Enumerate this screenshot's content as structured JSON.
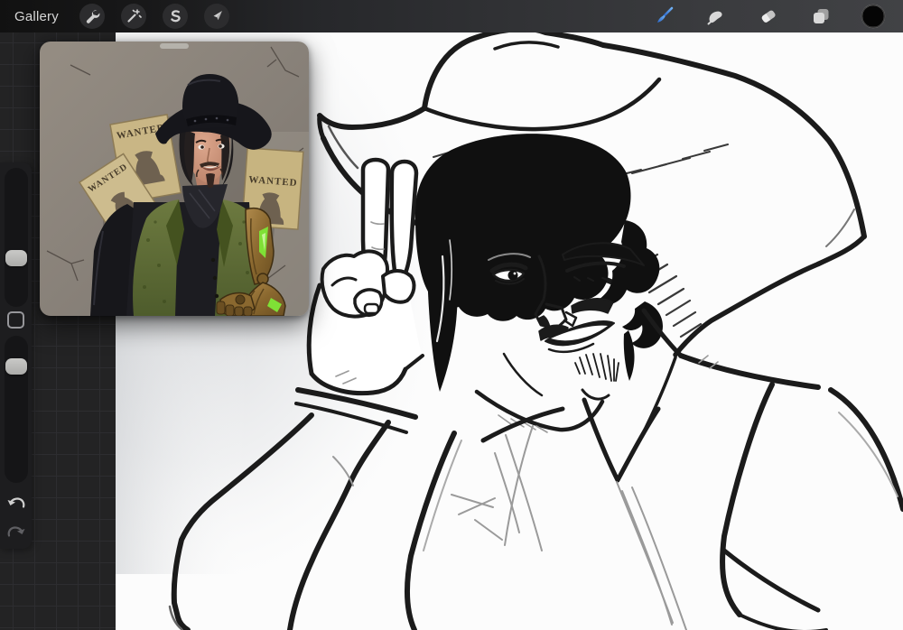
{
  "topbar": {
    "gallery_label": "Gallery",
    "left_tools": [
      {
        "label": "Actions",
        "icon": "wrench-icon"
      },
      {
        "label": "Adjustments",
        "icon": "magic-wand-icon"
      },
      {
        "label": "Selection",
        "icon": "selection-s-icon"
      },
      {
        "label": "Transform",
        "icon": "transform-arrow-icon"
      }
    ],
    "right_tools": [
      {
        "label": "Paint",
        "icon": "paintbrush-icon",
        "active": true
      },
      {
        "label": "Smudge",
        "icon": "smudge-finger-icon",
        "active": false
      },
      {
        "label": "Erase",
        "icon": "eraser-icon",
        "active": false
      },
      {
        "label": "Layers",
        "icon": "layers-icon",
        "active": false
      },
      {
        "label": "Color",
        "icon": "color-swatch-circle",
        "current_color": "#050505",
        "active": false
      }
    ]
  },
  "sidebar": {
    "sliders": [
      {
        "name": "brush-size-slider"
      },
      {
        "name": "brush-opacity-slider"
      }
    ],
    "modify_button": {
      "name": "modify-button"
    },
    "undo_label": "undo",
    "redo_label": "redo"
  },
  "reference_panel": {
    "posters": [
      {
        "label": "WANTED"
      },
      {
        "label": "WANTED"
      },
      {
        "label": "WANTED"
      }
    ],
    "subject": "cowboy with black hat, green vest and golden mechanical arm in front of cracked wall"
  },
  "canvas": {
    "content": "black ink line-art sketch of a winking cowboy tipping his hat with a two-finger salute"
  },
  "colors": {
    "accent_blue": "#3b82e0",
    "topbar_dark": "#1a1a1a",
    "desk_grid": "#232324",
    "sidebar_panel": "#1d1d1f",
    "canvas_white": "#fcfcfc",
    "ink": "#1b1b1b",
    "vest_green": "#66713a",
    "glow_green": "#7fe036",
    "arm_gold": "#9c7a42",
    "poster_tan": "#c9b685"
  }
}
